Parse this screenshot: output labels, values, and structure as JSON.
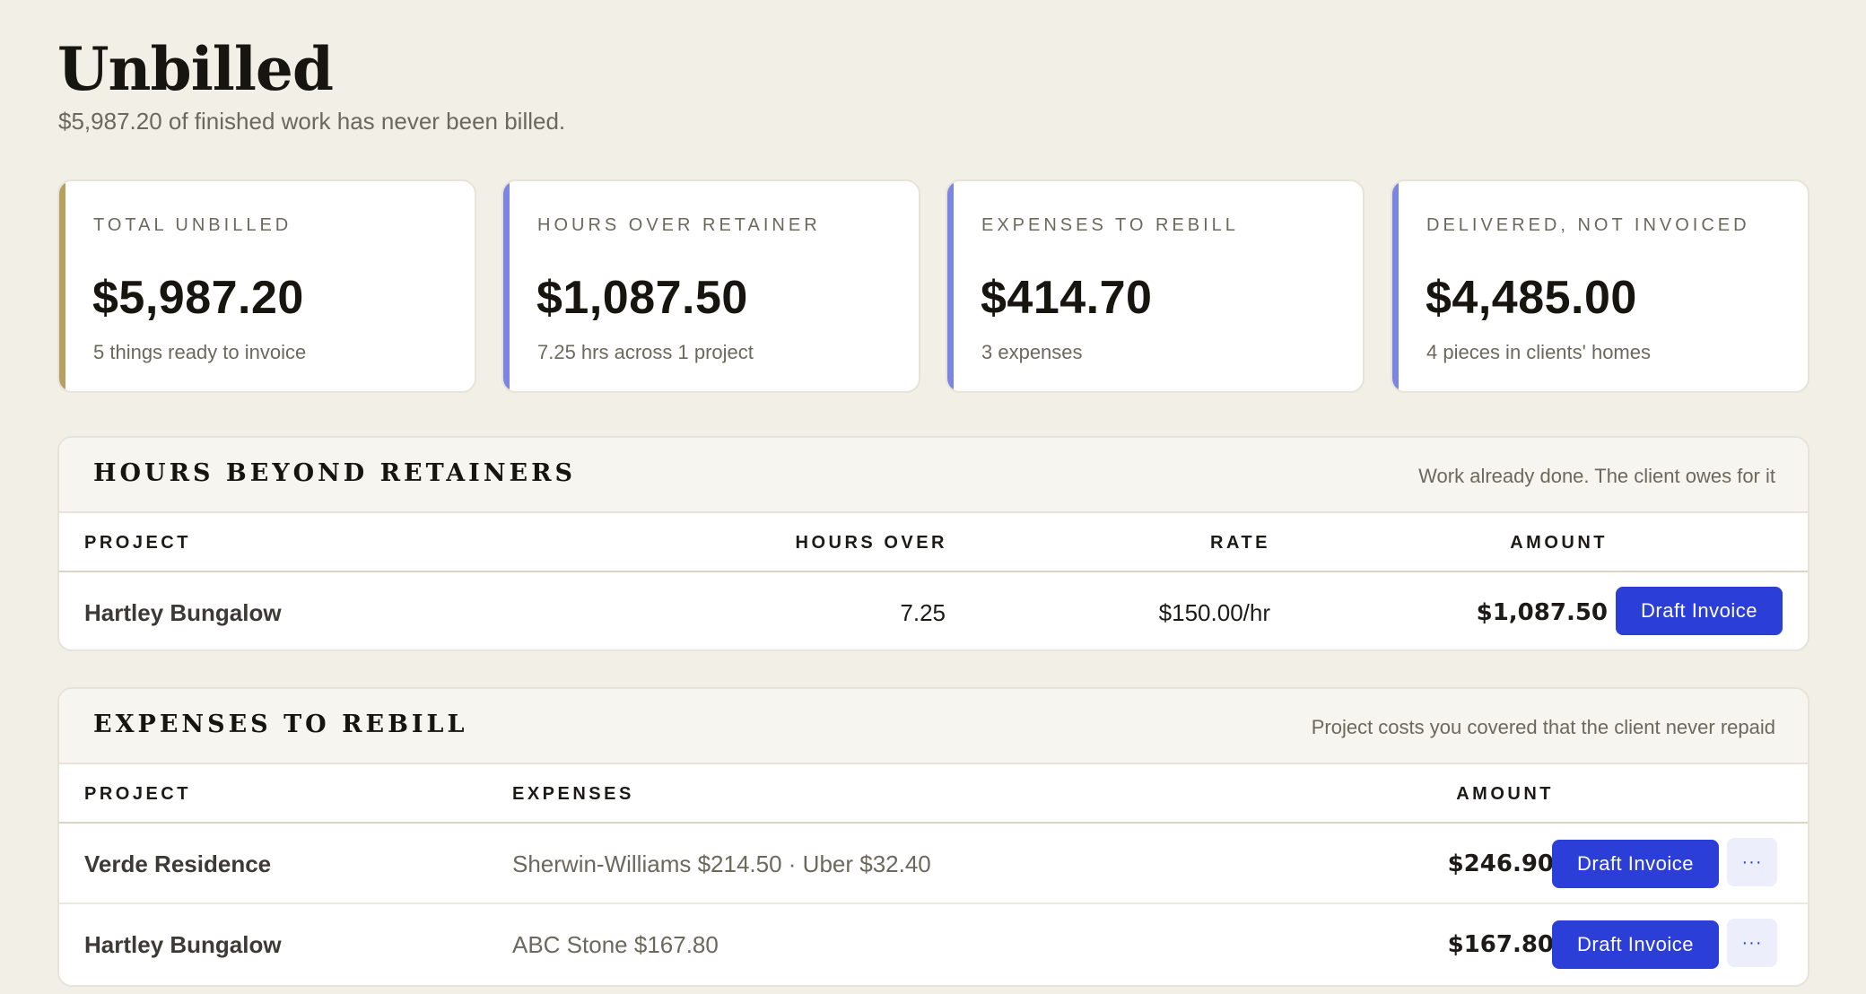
{
  "header": {
    "title": "Unbilled",
    "subtitle": "$5,987.20 of finished work has never been billed."
  },
  "stats": [
    {
      "label": "TOTAL UNBILLED",
      "value": "$5,987.20",
      "note": "5 things ready to invoice",
      "accent": "#b8a063"
    },
    {
      "label": "HOURS OVER RETAINER",
      "value": "$1,087.50",
      "note": "7.25 hrs across 1 project",
      "accent": "#7b86e2"
    },
    {
      "label": "EXPENSES TO REBILL",
      "value": "$414.70",
      "note": "3 expenses",
      "accent": "#7b86e2"
    },
    {
      "label": "DELIVERED, NOT INVOICED",
      "value": "$4,485.00",
      "note": "4 pieces in clients' homes",
      "accent": "#7b86e2"
    }
  ],
  "hours_panel": {
    "title": "HOURS BEYOND RETAINERS",
    "description": "Work already done. The client owes for it",
    "columns": {
      "project": "PROJECT",
      "hours": "HOURS OVER",
      "rate": "RATE",
      "amount": "AMOUNT"
    },
    "rows": [
      {
        "project": "Hartley Bungalow",
        "hours": "7.25",
        "rate": "$150.00/hr",
        "amount": "$1,087.50",
        "action": "Draft Invoice"
      }
    ]
  },
  "expenses_panel": {
    "title": "EXPENSES TO REBILL",
    "description": "Project costs you covered that the client never repaid",
    "columns": {
      "project": "PROJECT",
      "expenses": "EXPENSES",
      "amount": "AMOUNT"
    },
    "rows": [
      {
        "project": "Verde Residence",
        "expenses": "Sherwin-Williams $214.50 · Uber $32.40",
        "amount": "$246.90",
        "action": "Draft Invoice",
        "more": "···"
      },
      {
        "project": "Hartley Bungalow",
        "expenses": "ABC Stone $167.80",
        "amount": "$167.80",
        "action": "Draft Invoice",
        "more": "···"
      }
    ]
  },
  "colors": {
    "background": "#f2efe7",
    "primary_button": "#2b3ed8",
    "gold_accent": "#b8a063",
    "indigo_accent": "#7b86e2"
  }
}
